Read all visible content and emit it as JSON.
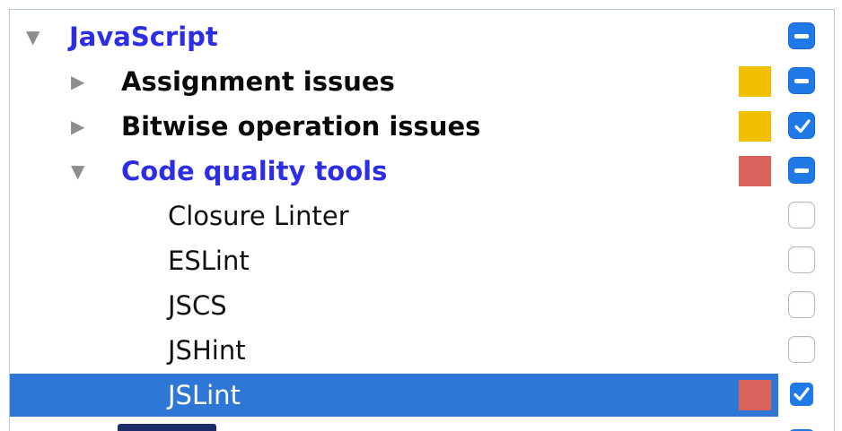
{
  "tree": {
    "root": {
      "label": "JavaScript",
      "state": "expanded",
      "checkbox": "mixed"
    },
    "categories": [
      {
        "label": "Assignment issues",
        "state": "collapsed",
        "severity_color": "#f0c000",
        "checkbox": "mixed"
      },
      {
        "label": "Bitwise operation issues",
        "state": "collapsed",
        "severity_color": "#f0c000",
        "checkbox": "checked"
      },
      {
        "label": "Code quality tools",
        "state": "expanded",
        "severity_color": "#d9625a",
        "checkbox": "mixed"
      }
    ],
    "children": [
      {
        "label": "Closure Linter",
        "checkbox": "unchecked"
      },
      {
        "label": "ESLint",
        "checkbox": "unchecked"
      },
      {
        "label": "JSCS",
        "checkbox": "unchecked"
      },
      {
        "label": "JSHint",
        "checkbox": "unchecked"
      },
      {
        "label": "JSLint",
        "checkbox": "checked",
        "selected": true,
        "severity_color": "#d9625a"
      }
    ]
  },
  "colors": {
    "expanded_label": "#2d2de6",
    "selection": "#2f77d6",
    "checkbox_blue": "#1f7ae8",
    "warning": "#f0c000",
    "error": "#d9625a"
  }
}
